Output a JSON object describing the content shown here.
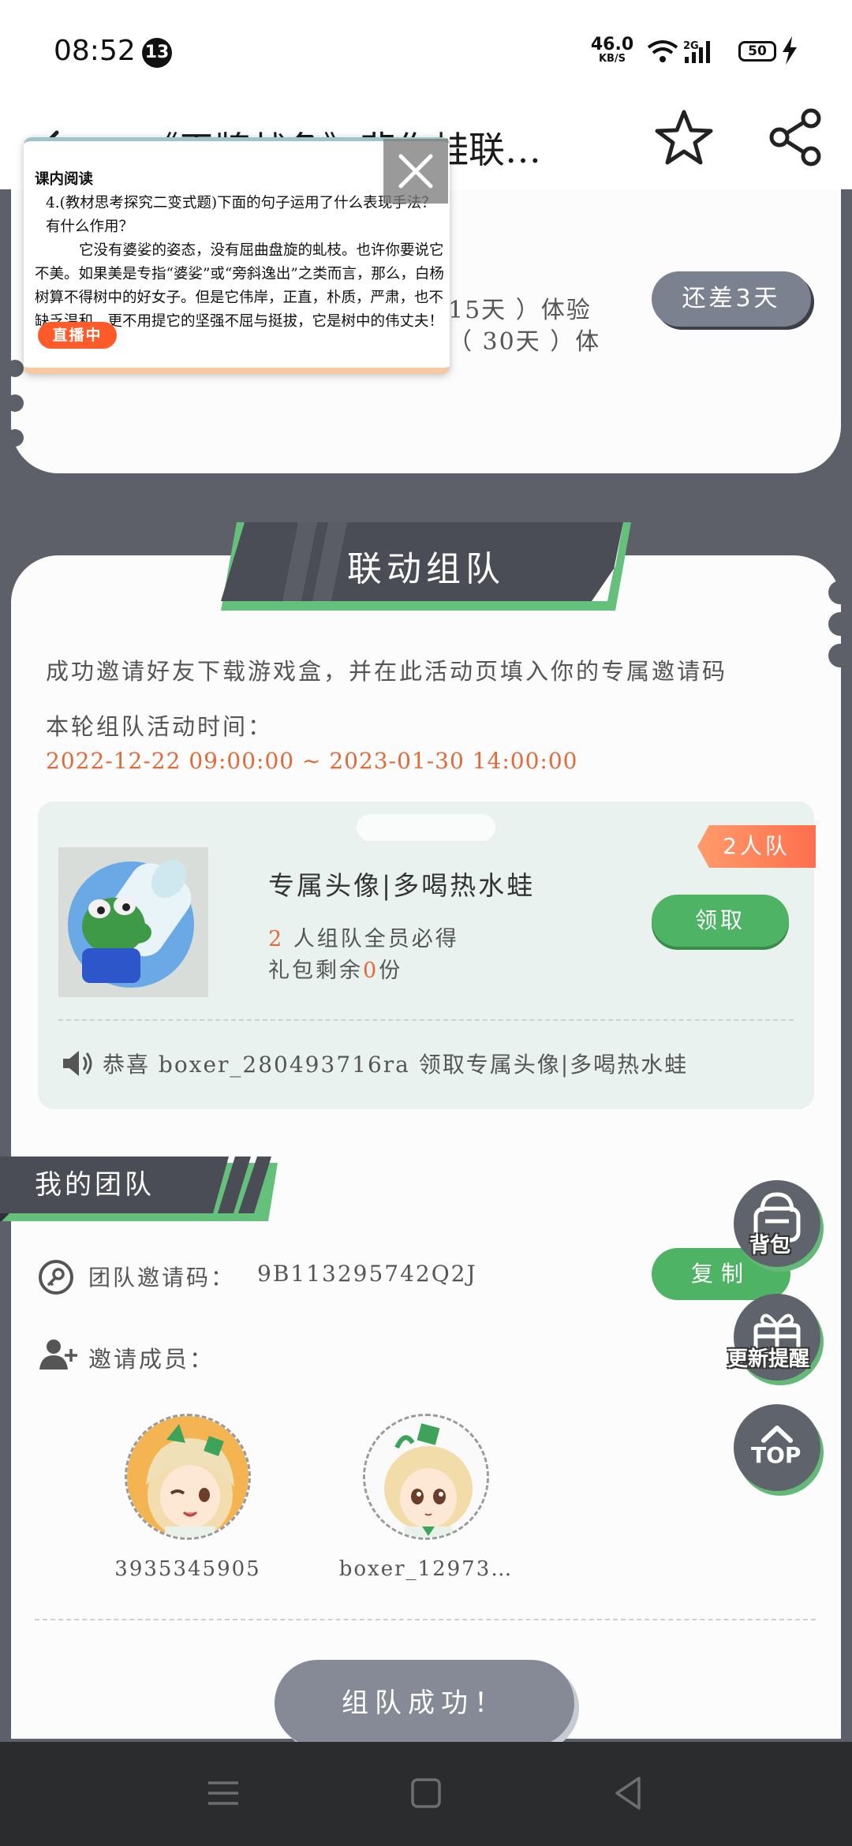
{
  "status_bar": {
    "time": "08:52",
    "notification_count": "13",
    "net_speed": "46.0",
    "net_unit": "KB/S",
    "signal_type": "2G",
    "battery": "50"
  },
  "header": {
    "title": "《王牌战争》悲伤蛙联…",
    "icons": [
      "back-arrow-icon",
      "star-icon",
      "share-icon"
    ]
  },
  "top_card": {
    "line1": "15天 ）体验",
    "line2": "（ 30天 ）体",
    "gap_button": "还差3天"
  },
  "video_overlay": {
    "heading": "课内阅读",
    "question": "4.(教材思考探究二变式题)下面的句子运用了什么表现手法？有什么作用？",
    "passage": "它没有婆娑的姿态，没有屈曲盘旋的虬枝。也许你要说它不美。如果美是专指“婆娑”或“旁斜逸出”之类而言，那么，白杨树算不得树中的好女子。但是它伟岸，正直，朴质，严肃，也不缺乏温和，更不用提它的坚强不屈与挺拔，它是树中的伟丈夫！",
    "live_badge": "直播中"
  },
  "section": {
    "title": "联动组队",
    "invite_desc": "成功邀请好友下载游戏盒，并在此活动页填入你的专属邀请码",
    "round_label": "本轮组队活动时间：",
    "round_time": "2022-12-22 09:00:00 ~ 2023-01-30 14:00:00"
  },
  "reward": {
    "team_tag": "2人队",
    "name": "专属头像|多喝热水蛙",
    "cond_num": "2",
    "cond_text": " 人组队全员必得",
    "left_prefix": "礼包剩余",
    "left_num": "0",
    "left_suffix": "份",
    "claim_label": "领取",
    "congrats": "恭喜 boxer_280493716ra 领取专属头像|多喝热水蛙"
  },
  "my_team": {
    "title": "我的团队",
    "code_label": "团队邀请码：",
    "code_value": "9B113295742Q2J",
    "copy_label": "复制",
    "members_label": "邀请成员：",
    "members": [
      {
        "name": "3935345905"
      },
      {
        "name": "boxer_12973…"
      }
    ],
    "success_label": "组队成功！"
  },
  "floating": {
    "bag_label": "背包",
    "update_label": "更新提醒",
    "top_label": "TOP"
  },
  "colors": {
    "accent_green": "#4fb365",
    "accent_orange": "#e26a3a",
    "dark_bg": "#5d6068",
    "card_bg": "#fbfcfb"
  }
}
